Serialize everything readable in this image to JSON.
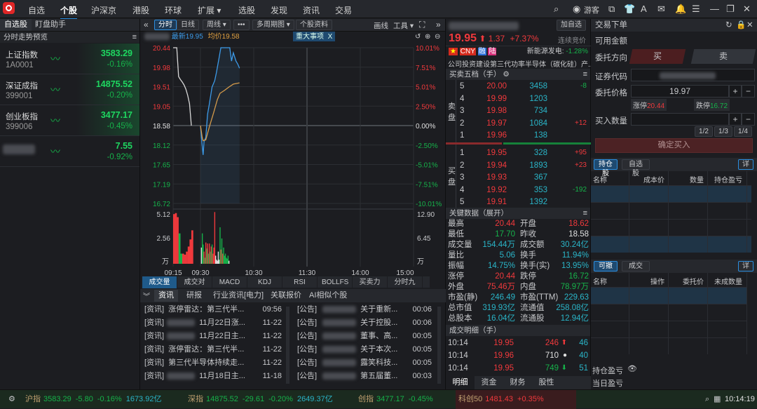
{
  "topbar": {
    "nav": [
      "自选",
      "个股",
      "沪深京",
      "港股",
      "环球",
      "扩展 ▾",
      "选股",
      "发现",
      "资讯",
      "交易"
    ],
    "active": 1,
    "user": "游客",
    "icons": [
      "search-icon",
      "user-icon",
      "popout-icon",
      "skin-icon",
      "font-icon",
      "mail-icon",
      "bell-icon",
      "list-icon",
      "minimize-icon",
      "restore-icon",
      "close-icon"
    ]
  },
  "left": {
    "tabs": [
      "自选股",
      "盯盘助手"
    ],
    "header": "分时走势预览",
    "items": [
      {
        "name": "上证指数",
        "code": "1A0001",
        "price": "3583.29",
        "pct": "-0.16%"
      },
      {
        "name": "深证成指",
        "code": "399001",
        "price": "14875.52",
        "pct": "-0.20%"
      },
      {
        "name": "创业板指",
        "code": "399006",
        "price": "3477.17",
        "pct": "-0.45%"
      },
      {
        "name": "",
        "code": "",
        "price": "7.55",
        "pct": "-0.92%"
      }
    ]
  },
  "toolbar": {
    "items": [
      "分时",
      "日线",
      "周线 ▾",
      "•••",
      "多周期图 ▾",
      "个股资料"
    ],
    "right": [
      "画线",
      "工具 ▾"
    ],
    "latest": "最新19.95",
    "avg": "均价19.58",
    "event": "重大事项",
    "event_close": "X"
  },
  "chart_data": {
    "type": "line",
    "y_left_ticks": [
      "20.44",
      "19.98",
      "19.51",
      "19.05",
      "18.58",
      "18.12",
      "17.65",
      "17.19",
      "16.72"
    ],
    "y_right_ticks": [
      "10.01%",
      "7.51%",
      "5.01%",
      "2.50%",
      "0.00%",
      "-2.50%",
      "-5.01%",
      "-7.51%",
      "-10.01%"
    ],
    "ylim": [
      16.72,
      20.44
    ],
    "prev_close": 18.58,
    "x_ticks": [
      "09:15",
      "09:30",
      "10:30",
      "11:30",
      "14:00",
      "15:00"
    ],
    "series": [
      {
        "role": "auction",
        "color": "#d8d8d8",
        "points": [
          [
            "09:15",
            20.44
          ],
          [
            "09:17",
            20.44
          ],
          [
            "09:18",
            19.75
          ],
          [
            "09:19",
            19.68
          ],
          [
            "09:20",
            19.62
          ],
          [
            "09:21",
            19.55
          ],
          [
            "09:22",
            19.45
          ],
          [
            "09:23",
            19.3
          ],
          [
            "09:24",
            19.1
          ],
          [
            "09:25",
            18.58
          ]
        ]
      },
      {
        "role": "price",
        "color": "#3c9ae8",
        "points": [
          [
            "09:30",
            18.58
          ],
          [
            "09:31",
            18.3
          ],
          [
            "09:33",
            17.88
          ],
          [
            "09:34",
            18.2
          ],
          [
            "09:36",
            18.3
          ],
          [
            "09:38",
            18.85
          ],
          [
            "09:40",
            19.1
          ],
          [
            "09:43",
            19.5
          ],
          [
            "09:46",
            19.65
          ],
          [
            "09:48",
            19.85
          ],
          [
            "09:51",
            20.2
          ],
          [
            "09:53",
            20.44
          ],
          [
            "10:03",
            20.44
          ],
          [
            "10:05",
            20.12
          ],
          [
            "10:07",
            20.32
          ],
          [
            "10:10",
            20.12
          ],
          [
            "10:12",
            20.05
          ],
          [
            "10:14",
            19.95
          ]
        ]
      },
      {
        "role": "average",
        "color": "#d49a4a",
        "points": [
          [
            "09:30",
            18.58
          ],
          [
            "09:32",
            18.3
          ],
          [
            "09:33",
            18.22
          ],
          [
            "09:36",
            18.24
          ],
          [
            "09:40",
            18.55
          ],
          [
            "09:45",
            18.9
          ],
          [
            "09:49",
            19.2
          ],
          [
            "09:52",
            19.35
          ],
          [
            "09:57",
            19.42
          ],
          [
            "10:02",
            19.5
          ],
          [
            "10:07",
            19.57
          ],
          [
            "10:14",
            19.6
          ]
        ]
      }
    ],
    "volume": {
      "unit": "万",
      "y_left_ticks": [
        "5.12",
        "2.56",
        "万"
      ],
      "y_right_ticks": [
        "12.90",
        "6.45",
        "万"
      ],
      "max": 5.12,
      "bars": [
        [
          "09:15",
          4.9,
          "r"
        ],
        [
          "09:16",
          5.0,
          "r"
        ],
        [
          "09:17",
          4.6,
          "r"
        ],
        [
          "09:18",
          3.0,
          "g"
        ],
        [
          "09:19",
          1.0,
          "g"
        ],
        [
          "09:20",
          1.0,
          "r"
        ],
        [
          "09:21",
          0.9,
          "r"
        ],
        [
          "09:22",
          1.2,
          "r"
        ],
        [
          "09:23",
          1.7,
          "r"
        ],
        [
          "09:24",
          2.4,
          "r"
        ],
        [
          "09:25",
          3.3,
          "r"
        ],
        [
          "09:31",
          1.6,
          "w"
        ],
        [
          "09:32",
          3.0,
          "g"
        ],
        [
          "09:33",
          1.9,
          "g"
        ],
        [
          "09:34",
          1.2,
          "r"
        ],
        [
          "09:35",
          0.6,
          "g"
        ],
        [
          "09:36",
          2.1,
          "r"
        ],
        [
          "09:37",
          1.5,
          "g"
        ],
        [
          "09:38",
          2.0,
          "r"
        ],
        [
          "09:39",
          1.0,
          "g"
        ],
        [
          "09:40",
          2.0,
          "r"
        ],
        [
          "09:41",
          1.2,
          "g"
        ],
        [
          "09:42",
          1.7,
          "r"
        ],
        [
          "09:43",
          1.9,
          "g"
        ],
        [
          "09:44",
          1.0,
          "r"
        ],
        [
          "09:45",
          1.6,
          "r"
        ],
        [
          "09:46",
          5.1,
          "r"
        ],
        [
          "09:47",
          0.8,
          "w"
        ],
        [
          "09:48",
          0.4,
          "w"
        ],
        [
          "09:49",
          0.3,
          "w"
        ],
        [
          "09:50",
          1.2,
          "w"
        ],
        [
          "09:51",
          0.4,
          "w"
        ],
        [
          "09:52",
          3.6,
          "g"
        ],
        [
          "09:53",
          1.4,
          "r"
        ],
        [
          "09:54",
          2.5,
          "g"
        ],
        [
          "09:55",
          1.0,
          "r"
        ],
        [
          "09:56",
          1.6,
          "g"
        ],
        [
          "09:57",
          0.8,
          "g"
        ],
        [
          "09:58",
          1.0,
          "g"
        ],
        [
          "09:59",
          0.6,
          "g"
        ],
        [
          "10:00",
          0.5,
          "g"
        ],
        [
          "10:01",
          0.8,
          "g"
        ],
        [
          "10:02",
          0.3,
          "w"
        ]
      ]
    }
  },
  "indicators": [
    "成交量",
    "成交对比",
    "MACD",
    "KDJ",
    "RSI",
    "BOLLFS",
    "买卖力道",
    "分时九转"
  ],
  "news": {
    "tabs": [
      "资讯",
      "研报",
      "行业资讯[电力]",
      "关联报价",
      "AI相似个股"
    ],
    "left": [
      {
        "tag": "[资讯]",
        "title": "涨停雷达：第三代半...",
        "time": "09:56",
        "blur": false
      },
      {
        "tag": "[资讯]",
        "title": "11月22日涨...",
        "time": "11-22",
        "blur": true
      },
      {
        "tag": "[资讯]",
        "title": "11月22日主...",
        "time": "11-22",
        "blur": true
      },
      {
        "tag": "[资讯]",
        "title": "涨停雷达：第三代半...",
        "time": "11-22",
        "blur": false
      },
      {
        "tag": "[资讯]",
        "title": "第三代半导体持续走...",
        "time": "11-22",
        "blur": false
      },
      {
        "tag": "[资讯]",
        "title": "11月18日主...",
        "time": "11-18",
        "blur": true
      }
    ],
    "right": [
      {
        "tag": "[公告]",
        "title": "关于重新...",
        "time": "00:06"
      },
      {
        "tag": "[公告]",
        "title": "关于控股...",
        "time": "00:06"
      },
      {
        "tag": "[公告]",
        "title": "董事、高...",
        "time": "00:05"
      },
      {
        "tag": "[公告]",
        "title": "关于本次...",
        "time": "00:05"
      },
      {
        "tag": "[公告]",
        "title": "露笑科技...",
        "time": "00:05"
      },
      {
        "tag": "[公告]",
        "title": "第五届董...",
        "time": "00:03"
      }
    ]
  },
  "quote": {
    "add_watch": "加自选",
    "price": "19.95",
    "change": "1.37",
    "pct": "+7.37%",
    "status": "连续竞价",
    "tags": [
      "CNY",
      "融",
      "陆"
    ],
    "sector": "新能源发电:",
    "sector_pct": "-1.28%",
    "desc": "公司投资建设第三代功率半导体（碳化硅）产...",
    "book_title": "买卖五档（手）",
    "ask_label": "卖盘",
    "bid_label": "买盘",
    "asks": [
      [
        "5",
        "20.00",
        "3458",
        "-8"
      ],
      [
        "4",
        "19.99",
        "1203",
        ""
      ],
      [
        "3",
        "19.98",
        "734",
        ""
      ],
      [
        "2",
        "19.97",
        "1084",
        "+12"
      ],
      [
        "1",
        "19.96",
        "138",
        ""
      ]
    ],
    "bids": [
      [
        "1",
        "19.95",
        "328",
        "+95"
      ],
      [
        "2",
        "19.94",
        "1893",
        "+23"
      ],
      [
        "3",
        "19.93",
        "367",
        ""
      ],
      [
        "4",
        "19.92",
        "353",
        "-192"
      ],
      [
        "5",
        "19.91",
        "1392",
        ""
      ]
    ],
    "key_title": "关键数据（展开）",
    "key": [
      [
        "最高",
        "20.44",
        "red",
        "开盘",
        "18.62",
        "red"
      ],
      [
        "最低",
        "17.70",
        "green",
        "昨收",
        "18.58",
        "white"
      ],
      [
        "成交量",
        "154.44万",
        "cyan",
        "成交额",
        "30.24亿",
        "cyan"
      ],
      [
        "量比",
        "5.06",
        "cyan",
        "换手",
        "11.94%",
        "cyan"
      ],
      [
        "振幅",
        "14.75%",
        "cyan",
        "换手(实)",
        "13.95%",
        "cyan"
      ],
      [
        "涨停",
        "20.44",
        "red",
        "跌停",
        "16.72",
        "green"
      ],
      [
        "外盘",
        "75.46万",
        "red",
        "内盘",
        "78.97万",
        "green"
      ],
      [
        "市盈(静)",
        "246.49",
        "cyan",
        "市盈(TTM)",
        "229.63",
        "cyan"
      ],
      [
        "总市值",
        "319.93亿",
        "cyan",
        "流通值",
        "258.08亿",
        "cyan"
      ],
      [
        "总股本",
        "16.04亿",
        "cyan",
        "流通股",
        "12.94亿",
        "cyan"
      ]
    ],
    "trades_title": "成交明细（手）",
    "trades": [
      [
        "10:14",
        "19.95",
        "246",
        "up",
        "46"
      ],
      [
        "10:14",
        "19.96",
        "710",
        "neutral",
        "40"
      ],
      [
        "10:14",
        "19.95",
        "749",
        "down",
        "51"
      ]
    ],
    "bottom_tabs": [
      "明细",
      "资金",
      "财务",
      "股性"
    ]
  },
  "trade": {
    "title": "交易下单",
    "available": "可用金额",
    "direction": "委托方向",
    "buy": "买",
    "sell": "卖",
    "code_label": "证券代码",
    "price_label": "委托价格",
    "price": "19.97",
    "limit_up_label": "涨停",
    "limit_up": "20.44",
    "limit_down_label": "跌停",
    "limit_down": "16.72",
    "qty_label": "买入数量",
    "fractions": [
      "1/2",
      "1/3",
      "1/4"
    ],
    "confirm": "确定买入",
    "hold_tabs": [
      "持仓股",
      "自选股"
    ],
    "detail": "详",
    "hold_cols": [
      "名称",
      "成本价",
      "数量",
      "持仓盈亏"
    ],
    "order_tabs": [
      "可撤",
      "成交"
    ],
    "order_cols": [
      "名称",
      "操作",
      "委托价",
      "未成数量"
    ],
    "pnl_hold": "持仓盈亏",
    "pnl_day": "当日盈亏"
  },
  "status": {
    "items": [
      {
        "name": "沪指",
        "val": "3583.29",
        "chg": "-5.80",
        "pct": "-0.16%",
        "amt": "1673.92亿",
        "c": "green"
      },
      {
        "name": "深指",
        "val": "14875.52",
        "chg": "-29.61",
        "pct": "-0.20%",
        "amt": "2649.37亿",
        "c": "green"
      },
      {
        "name": "创指",
        "val": "3477.17",
        "chg": "",
        "pct": "-0.45%",
        "amt": "",
        "c": "green"
      },
      {
        "name": "科创50",
        "val": "1481.43",
        "chg": "",
        "pct": "+0.35%",
        "amt": "",
        "c": "red"
      }
    ],
    "time": "10:14:19"
  }
}
